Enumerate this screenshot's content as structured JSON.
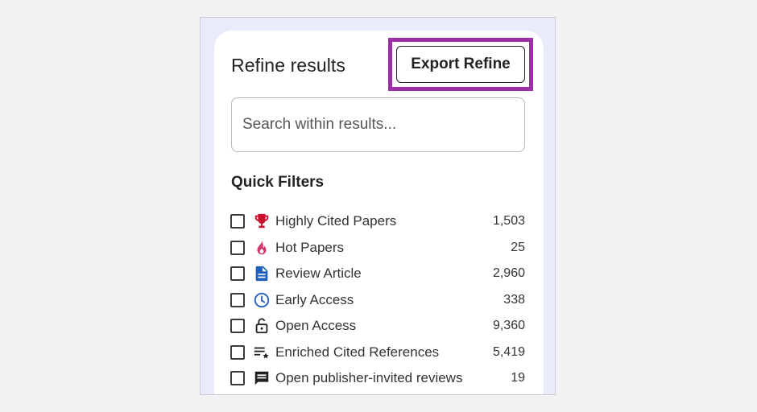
{
  "panel": {
    "title": "Refine results",
    "export_button_label": "Export Refine"
  },
  "search": {
    "placeholder": "Search within results...",
    "value": ""
  },
  "quick_filters": {
    "heading": "Quick Filters",
    "items": [
      {
        "label": "Highly Cited Papers",
        "count": "1,503",
        "icon": "trophy-icon",
        "checked": false
      },
      {
        "label": "Hot Papers",
        "count": "25",
        "icon": "flame-icon",
        "checked": false
      },
      {
        "label": "Review Article",
        "count": "2,960",
        "icon": "document-icon",
        "checked": false
      },
      {
        "label": "Early Access",
        "count": "338",
        "icon": "clock-icon",
        "checked": false
      },
      {
        "label": "Open Access",
        "count": "9,360",
        "icon": "lock-open-icon",
        "checked": false
      },
      {
        "label": "Enriched Cited References",
        "count": "5,419",
        "icon": "list-star-icon",
        "checked": false
      },
      {
        "label": "Open publisher-invited reviews",
        "count": "19",
        "icon": "comment-icon",
        "checked": false
      }
    ]
  },
  "colors": {
    "highlight": "#9b2fa6",
    "trophy": "#c8102e",
    "flame": "#d2396b",
    "document": "#1f5fbf",
    "clock": "#1f5fbf",
    "panel_background": "#e9ebfb"
  }
}
